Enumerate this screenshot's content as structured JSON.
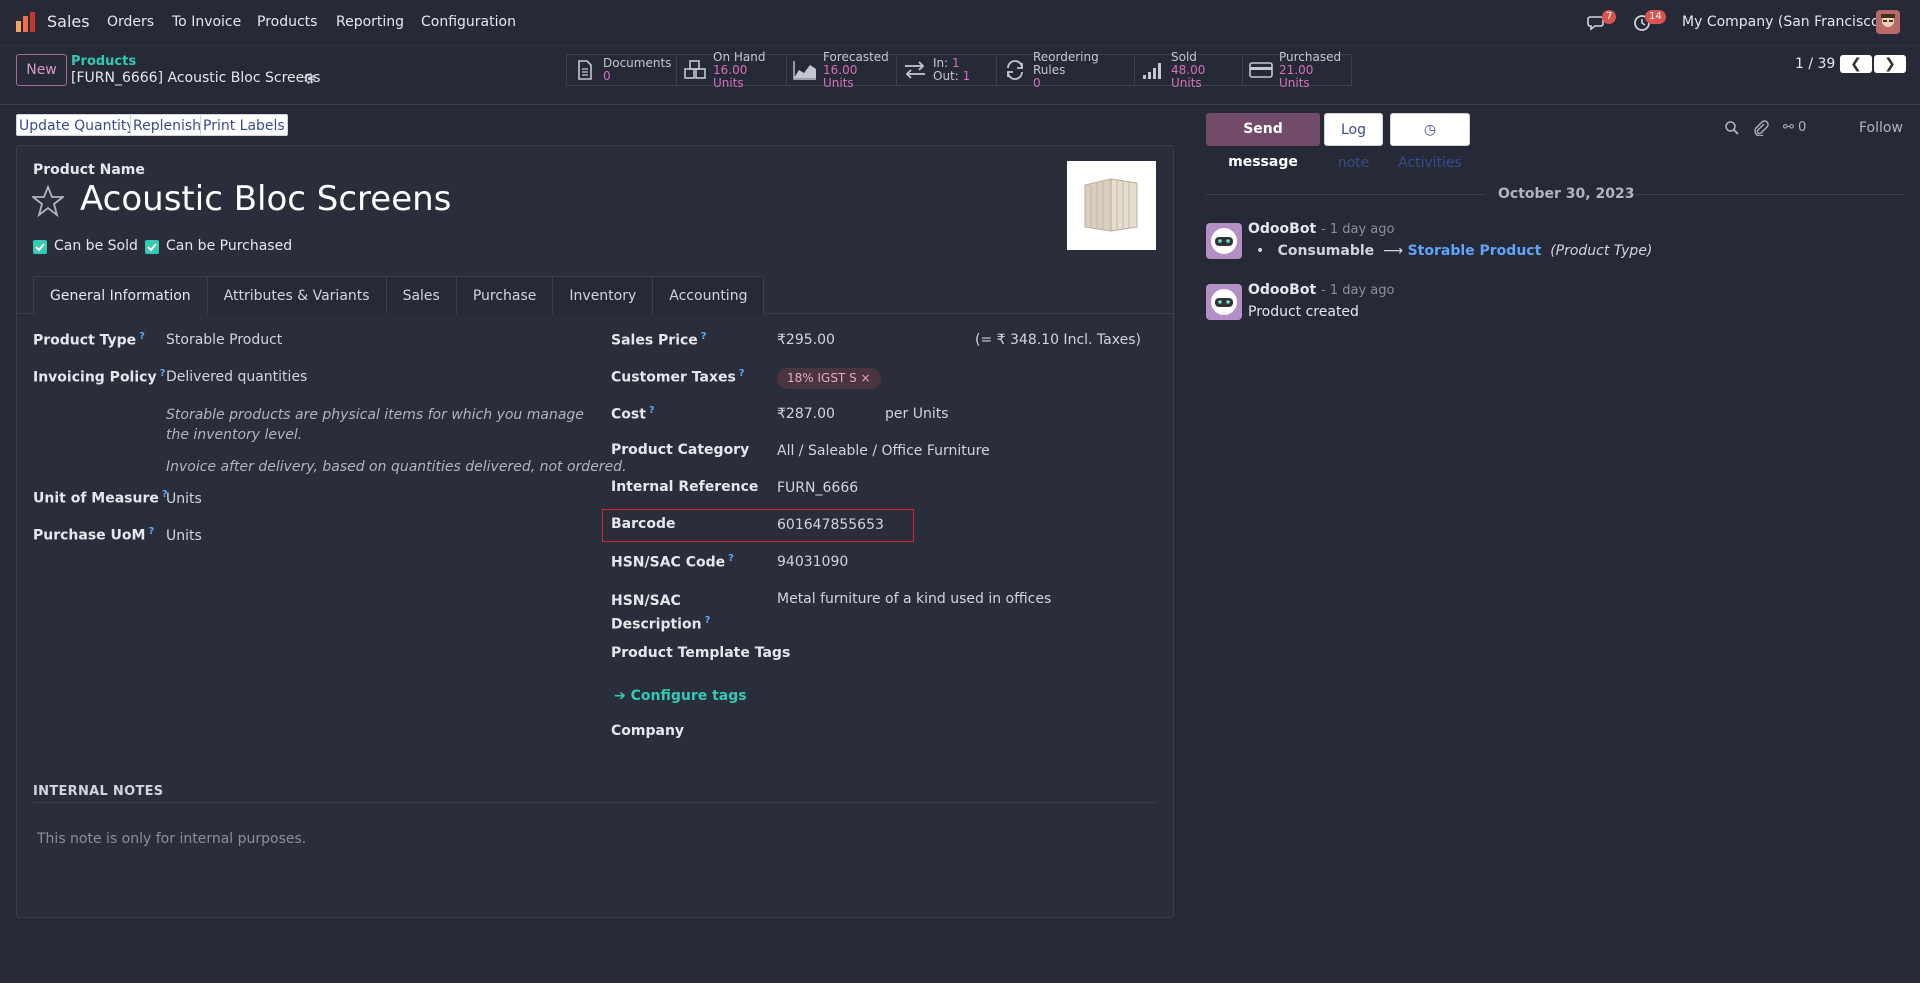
{
  "navbar": {
    "app_name": "Sales",
    "menu": [
      "Orders",
      "To Invoice",
      "Products",
      "Reporting",
      "Configuration"
    ],
    "messages_badge": "7",
    "activities_badge": "14",
    "company": "My Company (San Francisco)"
  },
  "control": {
    "new_label": "New",
    "breadcrumb_parent": "Products",
    "breadcrumb_current": "[FURN_6666] Acoustic Bloc Screens",
    "smart_buttons": [
      {
        "label": "Documents",
        "value": "0",
        "icon": "document-icon"
      },
      {
        "label": "On Hand",
        "value": "16.00 Units",
        "icon": "boxes-icon"
      },
      {
        "label": "Forecasted",
        "value": "16.00 Units",
        "icon": "area-chart-icon"
      },
      {
        "label": "In:",
        "value": "1",
        "label2": "Out:",
        "value2": "1",
        "icon": "exchange-icon"
      },
      {
        "label": "Reordering Rules",
        "value": "0",
        "icon": "refresh-icon"
      },
      {
        "label": "Sold",
        "value": "48.00 Units",
        "icon": "signal-icon"
      },
      {
        "label": "Purchased",
        "value": "21.00 Units",
        "icon": "credit-card-icon"
      }
    ],
    "pager": "1 / 39"
  },
  "actions": {
    "update_quantity": "Update Quantity",
    "replenish": "Replenish",
    "print_labels": "Print Labels"
  },
  "form": {
    "product_name_label": "Product Name",
    "product_name": "Acoustic Bloc Screens",
    "can_be_sold": "Can be Sold",
    "can_be_purchased": "Can be Purchased",
    "tabs": [
      "General Information",
      "Attributes & Variants",
      "Sales",
      "Purchase",
      "Inventory",
      "Accounting"
    ],
    "active_tab": "General Information",
    "left": {
      "product_type_label": "Product Type",
      "product_type": "Storable Product",
      "invoicing_policy_label": "Invoicing Policy",
      "invoicing_policy": "Delivered quantities",
      "help_1": "Storable products are physical items for which you manage the inventory level.",
      "help_2": "Invoice after delivery, based on quantities delivered, not ordered.",
      "uom_label": "Unit of Measure",
      "uom": "Units",
      "purchase_uom_label": "Purchase UoM",
      "purchase_uom": "Units"
    },
    "right": {
      "sales_price_label": "Sales Price",
      "sales_price": "₹295.00",
      "incl_taxes": "(= ₹ 348.10 Incl. Taxes)",
      "customer_taxes_label": "Customer Taxes",
      "customer_tax_tag": "18% IGST S",
      "cost_label": "Cost",
      "cost": "₹287.00",
      "cost_unit": "per Units",
      "category_label": "Product Category",
      "category": "All / Saleable / Office Furniture",
      "internal_ref_label": "Internal Reference",
      "internal_ref": "FURN_6666",
      "barcode_label": "Barcode",
      "barcode": "601647855653",
      "hsn_code_label": "HSN/SAC Code",
      "hsn_code": "94031090",
      "hsn_desc_label_1": "HSN/SAC",
      "hsn_desc_label_2": "Description",
      "hsn_desc": "Metal furniture of a kind used in offices",
      "template_tags_label": "Product Template Tags",
      "configure_tags": "Configure tags",
      "company_label": "Company"
    },
    "internal_notes_header": "INTERNAL NOTES",
    "internal_notes_placeholder": "This note is only for internal purposes."
  },
  "chatter": {
    "send_message": "Send message",
    "log_note": "Log note",
    "activities": "Activities",
    "followers_count": "0",
    "follow": "Follow",
    "date": "October 30, 2023",
    "messages": [
      {
        "author": "OdooBot",
        "ago": "- 1 day ago",
        "old_value": "Consumable",
        "new_value": "Storable Product",
        "field": "(Product Type)"
      },
      {
        "author": "OdooBot",
        "ago": "- 1 day ago",
        "body": "Product created"
      }
    ]
  },
  "colors": {
    "background": "#262a36",
    "accent_teal": "#35c9b4",
    "accent_purple": "#714b67",
    "smart_value": "#d46fb9",
    "highlight_border": "#e0202a"
  }
}
